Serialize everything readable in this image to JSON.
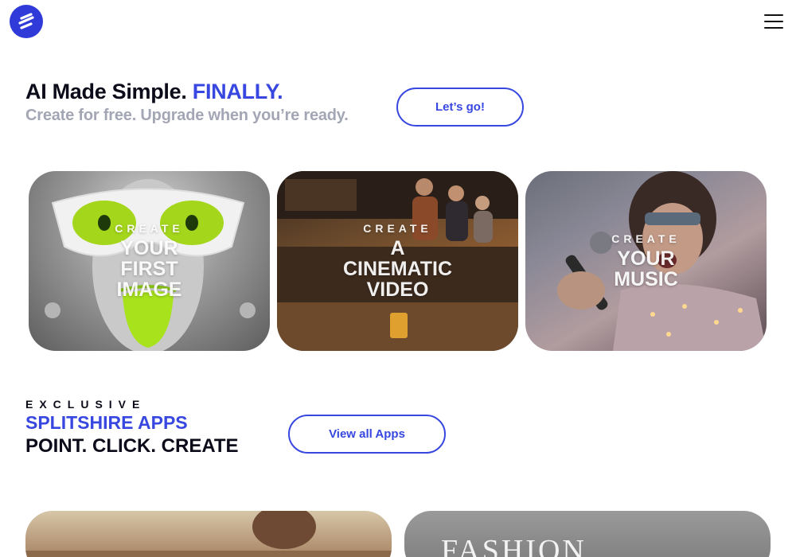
{
  "header": {
    "logo_icon": "splitshire-logo-icon",
    "menu_icon": "hamburger-menu-icon"
  },
  "hero": {
    "title_main": "AI Made Simple.",
    "title_accent": "FINALLY.",
    "subtitle": "Create for free. Upgrade when you’re ready.",
    "cta_label": "Let’s go!"
  },
  "cards": [
    {
      "kicker": "CREATE",
      "headline": [
        "YOUR",
        "FIRST",
        "IMAGE"
      ]
    },
    {
      "kicker": "CREATE",
      "headline": [
        "A",
        "CINEMATIC",
        "VIDEO"
      ]
    },
    {
      "kicker": "CREATE",
      "headline": [
        "YOUR",
        "MUSIC"
      ]
    }
  ],
  "apps": {
    "kicker": "EXCLUSIVE",
    "title": "SPLITSHIRE APPS",
    "tagline": "POINT. CLICK. CREATE",
    "cta_label": "View all Apps"
  },
  "bottom_cards": [
    {
      "text": ""
    },
    {
      "text": "FASHION"
    }
  ],
  "colors": {
    "accent": "#3747e0",
    "text_dark": "#0b0b1a",
    "text_muted": "#a3a6b4"
  }
}
